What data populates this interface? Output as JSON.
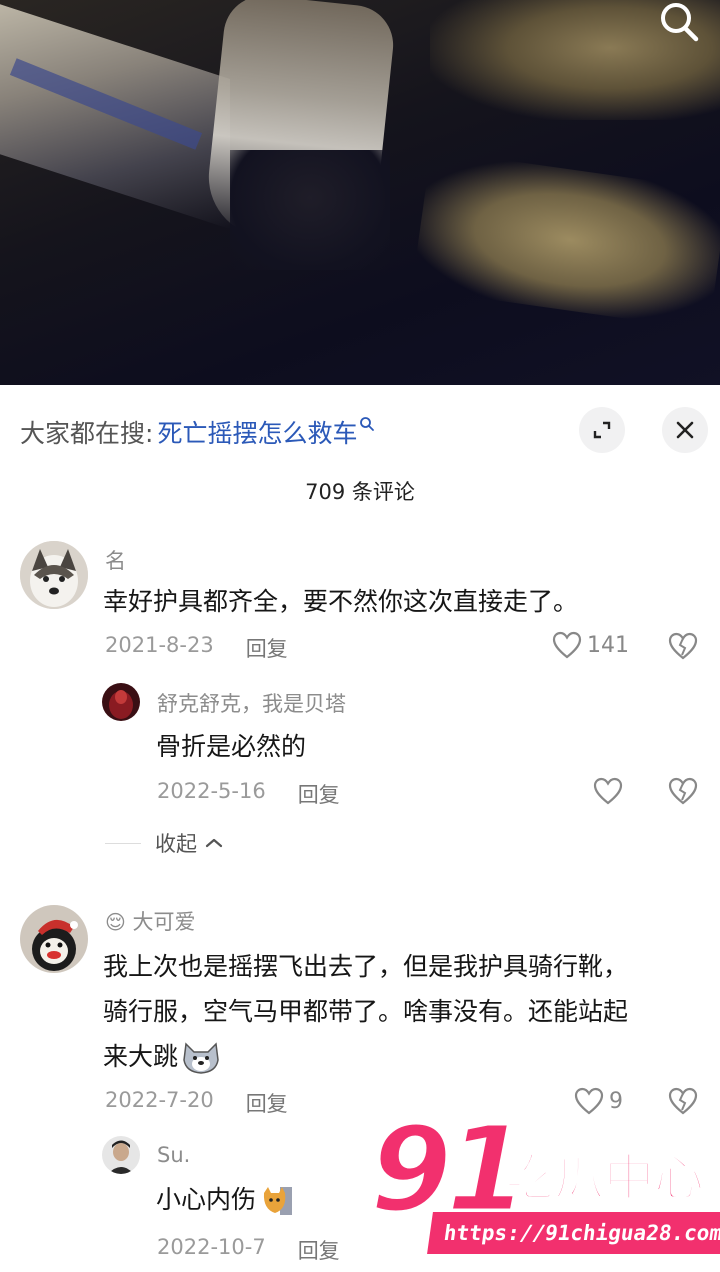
{
  "header": {
    "hot_search_label": "大家都在搜:",
    "hot_search_term": "死亡摇摆怎么救车",
    "hot_search_icon": "search-icon"
  },
  "comment_count": "709 条评论",
  "comments": [
    {
      "username": "名",
      "text_lines": [
        "幸好护具都齐全，要不然你这次直接走了。"
      ],
      "date": "2021-8-23",
      "reply_label": "回复",
      "likes": "141",
      "replies": [
        {
          "username": "舒克舒克，我是贝塔",
          "text_lines": [
            "骨折是必然的"
          ],
          "date": "2022-5-16",
          "reply_label": "回复"
        }
      ],
      "collapse_label": "收起"
    },
    {
      "username_emoji": "😌",
      "username": "大可爱",
      "text_lines": [
        "我上次也是摇摆飞出去了，但是我护具骑行靴，",
        "骑行服，空气马甲都带了。啥事没有。还能站起",
        "来大跳"
      ],
      "emoji": "wolf-emoji",
      "date": "2022-7-20",
      "reply_label": "回复",
      "likes": "9",
      "replies": [
        {
          "username": "Su.",
          "text_lines": [
            "小心内伤"
          ],
          "emoji": "cat-emoji",
          "date": "2022-10-7",
          "reply_label": "回复"
        }
      ]
    }
  ],
  "watermark": {
    "number": "91",
    "chinese": "吃瓜中心",
    "url": "https://91chigua28.com"
  },
  "colors": {
    "link_blue": "#2b59b8",
    "watermark_pink": "#f2306e"
  }
}
